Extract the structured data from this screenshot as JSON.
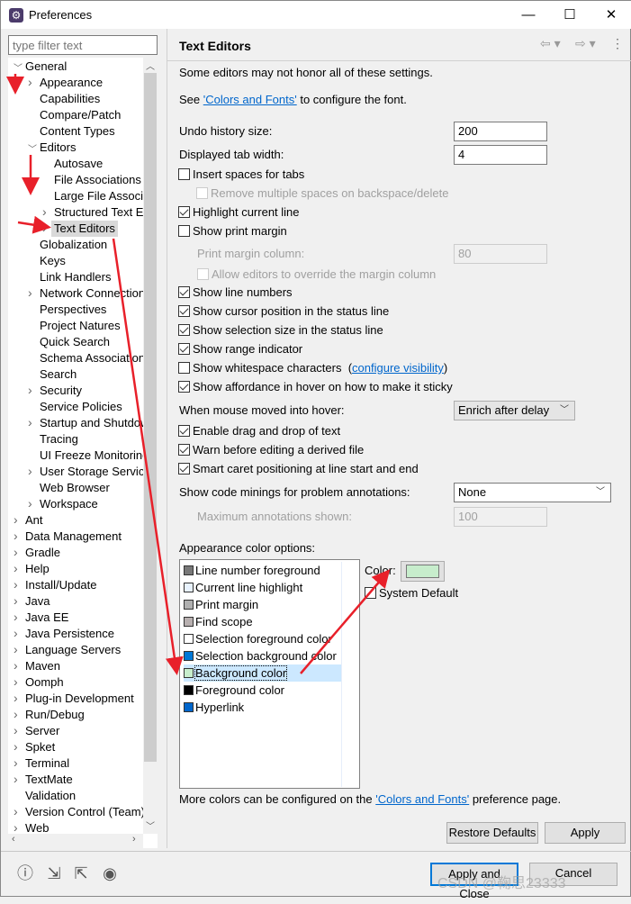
{
  "window": {
    "title": "Preferences",
    "minimize": "—",
    "maximize": "☐",
    "close": "✕"
  },
  "filter": {
    "placeholder": "type filter text"
  },
  "tree": [
    {
      "label": "General",
      "level": 0,
      "expanded": true
    },
    {
      "label": "Appearance",
      "level": 1,
      "collapsed": true
    },
    {
      "label": "Capabilities",
      "level": 1
    },
    {
      "label": "Compare/Patch",
      "level": 1
    },
    {
      "label": "Content Types",
      "level": 1
    },
    {
      "label": "Editors",
      "level": 1,
      "expanded": true
    },
    {
      "label": "Autosave",
      "level": 2
    },
    {
      "label": "File Associations",
      "level": 2
    },
    {
      "label": "Large File Associations",
      "level": 2
    },
    {
      "label": "Structured Text Editors",
      "level": 2,
      "collapsed": true
    },
    {
      "label": "Text Editors",
      "level": 2,
      "selected": true,
      "collapsed": true
    },
    {
      "label": "Globalization",
      "level": 1
    },
    {
      "label": "Keys",
      "level": 1
    },
    {
      "label": "Link Handlers",
      "level": 1
    },
    {
      "label": "Network Connections",
      "level": 1,
      "collapsed": true
    },
    {
      "label": "Perspectives",
      "level": 1
    },
    {
      "label": "Project Natures",
      "level": 1
    },
    {
      "label": "Quick Search",
      "level": 1
    },
    {
      "label": "Schema Associations",
      "level": 1
    },
    {
      "label": "Search",
      "level": 1
    },
    {
      "label": "Security",
      "level": 1,
      "collapsed": true
    },
    {
      "label": "Service Policies",
      "level": 1
    },
    {
      "label": "Startup and Shutdown",
      "level": 1,
      "collapsed": true
    },
    {
      "label": "Tracing",
      "level": 1
    },
    {
      "label": "UI Freeze Monitoring",
      "level": 1
    },
    {
      "label": "User Storage Service",
      "level": 1,
      "collapsed": true
    },
    {
      "label": "Web Browser",
      "level": 1
    },
    {
      "label": "Workspace",
      "level": 1,
      "collapsed": true
    },
    {
      "label": "Ant",
      "level": 0,
      "collapsed": true
    },
    {
      "label": "Data Management",
      "level": 0,
      "collapsed": true
    },
    {
      "label": "Gradle",
      "level": 0,
      "collapsed": true
    },
    {
      "label": "Help",
      "level": 0,
      "collapsed": true
    },
    {
      "label": "Install/Update",
      "level": 0,
      "collapsed": true
    },
    {
      "label": "Java",
      "level": 0,
      "collapsed": true
    },
    {
      "label": "Java EE",
      "level": 0,
      "collapsed": true
    },
    {
      "label": "Java Persistence",
      "level": 0,
      "collapsed": true
    },
    {
      "label": "Language Servers",
      "level": 0,
      "collapsed": true
    },
    {
      "label": "Maven",
      "level": 0,
      "collapsed": true
    },
    {
      "label": "Oomph",
      "level": 0,
      "collapsed": true
    },
    {
      "label": "Plug-in Development",
      "level": 0,
      "collapsed": true
    },
    {
      "label": "Run/Debug",
      "level": 0,
      "collapsed": true
    },
    {
      "label": "Server",
      "level": 0,
      "collapsed": true
    },
    {
      "label": "Spket",
      "level": 0,
      "collapsed": true
    },
    {
      "label": "Terminal",
      "level": 0,
      "collapsed": true
    },
    {
      "label": "TextMate",
      "level": 0,
      "collapsed": true
    },
    {
      "label": "Validation",
      "level": 0
    },
    {
      "label": "Version Control (Team)",
      "level": 0,
      "collapsed": true
    },
    {
      "label": "Web",
      "level": 0,
      "collapsed": true
    }
  ],
  "page": {
    "title": "Text Editors",
    "note": "Some editors may not honor all of these settings.",
    "see_prefix": "See ",
    "see_link": "'Colors and Fonts'",
    "see_suffix": " to configure the font.",
    "undo_label": "Undo history size:",
    "undo_value": "200",
    "tab_label": "Displayed tab width:",
    "tab_value": "4",
    "checks": [
      {
        "label": "Insert spaces for tabs",
        "checked": false
      },
      {
        "label": "Remove multiple spaces on backspace/delete",
        "checked": false,
        "disabled": true
      },
      {
        "label": "Highlight current line",
        "checked": true
      },
      {
        "label": "Show print margin",
        "checked": false
      }
    ],
    "margin_label": "Print margin column:",
    "margin_value": "80",
    "allow_override": "Allow editors to override the margin column",
    "checks2": [
      {
        "label": "Show line numbers",
        "checked": true
      },
      {
        "label": "Show cursor position in the status line",
        "checked": true
      },
      {
        "label": "Show selection size in the status line",
        "checked": true
      },
      {
        "label": "Show range indicator",
        "checked": true
      },
      {
        "label": "Show whitespace characters",
        "checked": false
      },
      {
        "label": "Show affordance in hover on how to make it sticky",
        "checked": true
      }
    ],
    "whitespace_link": "configure visibility",
    "hover_label": "When mouse moved into hover:",
    "hover_value": "Enrich after delay",
    "checks3": [
      {
        "label": "Enable drag and drop of text",
        "checked": true
      },
      {
        "label": "Warn before editing a derived file",
        "checked": true
      },
      {
        "label": "Smart caret positioning at line start and end",
        "checked": true
      }
    ],
    "minings_label": "Show code minings for problem annotations:",
    "minings_value": "None",
    "max_ann_label": "Maximum annotations shown:",
    "max_ann_value": "100",
    "appearance_label": "Appearance color options:",
    "color_items": [
      {
        "label": "Line number foreground",
        "color": "#787878"
      },
      {
        "label": "Current line highlight",
        "color": "#e8f2fe"
      },
      {
        "label": "Print margin",
        "color": "#b0b0b0"
      },
      {
        "label": "Find scope",
        "color": "#b8b0b0"
      },
      {
        "label": "Selection foreground color",
        "color": "#ffffff"
      },
      {
        "label": "Selection background color",
        "color": "#0078d7"
      },
      {
        "label": "Background color",
        "color": "#c7edcc",
        "selected": true
      },
      {
        "label": "Foreground color",
        "color": "#000000"
      },
      {
        "label": "Hyperlink",
        "color": "#0066cc"
      }
    ],
    "color_label": "Color:",
    "color_value": "#c7edcc",
    "system_default": "System Default",
    "more_prefix": "More colors can be configured on the ",
    "more_link": "'Colors and Fonts'",
    "more_suffix": " preference page.",
    "restore": "Restore Defaults",
    "apply": "Apply"
  },
  "footer": {
    "apply_close": "Apply and Close",
    "cancel": "Cancel"
  },
  "watermark": "CSDN @鞠思23333",
  "colors": {
    "selection": "#cce8ff",
    "link": "#0066cc",
    "annotation_arrow": "#e8202a"
  }
}
